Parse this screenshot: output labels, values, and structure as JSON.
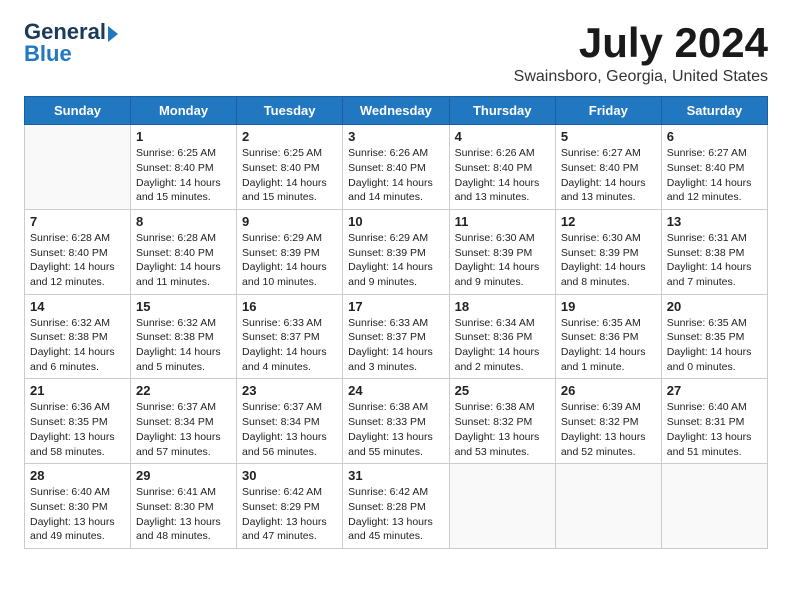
{
  "header": {
    "logo_general": "General",
    "logo_blue": "Blue",
    "month_year": "July 2024",
    "location": "Swainsboro, Georgia, United States"
  },
  "days_of_week": [
    "Sunday",
    "Monday",
    "Tuesday",
    "Wednesday",
    "Thursday",
    "Friday",
    "Saturday"
  ],
  "weeks": [
    [
      {
        "day": "",
        "content": ""
      },
      {
        "day": "1",
        "content": "Sunrise: 6:25 AM\nSunset: 8:40 PM\nDaylight: 14 hours\nand 15 minutes."
      },
      {
        "day": "2",
        "content": "Sunrise: 6:25 AM\nSunset: 8:40 PM\nDaylight: 14 hours\nand 15 minutes."
      },
      {
        "day": "3",
        "content": "Sunrise: 6:26 AM\nSunset: 8:40 PM\nDaylight: 14 hours\nand 14 minutes."
      },
      {
        "day": "4",
        "content": "Sunrise: 6:26 AM\nSunset: 8:40 PM\nDaylight: 14 hours\nand 13 minutes."
      },
      {
        "day": "5",
        "content": "Sunrise: 6:27 AM\nSunset: 8:40 PM\nDaylight: 14 hours\nand 13 minutes."
      },
      {
        "day": "6",
        "content": "Sunrise: 6:27 AM\nSunset: 8:40 PM\nDaylight: 14 hours\nand 12 minutes."
      }
    ],
    [
      {
        "day": "7",
        "content": ""
      },
      {
        "day": "8",
        "content": "Sunrise: 6:28 AM\nSunset: 8:40 PM\nDaylight: 14 hours\nand 11 minutes."
      },
      {
        "day": "9",
        "content": "Sunrise: 6:29 AM\nSunset: 8:39 PM\nDaylight: 14 hours\nand 10 minutes."
      },
      {
        "day": "10",
        "content": "Sunrise: 6:29 AM\nSunset: 8:39 PM\nDaylight: 14 hours\nand 9 minutes."
      },
      {
        "day": "11",
        "content": "Sunrise: 6:30 AM\nSunset: 8:39 PM\nDaylight: 14 hours\nand 9 minutes."
      },
      {
        "day": "12",
        "content": "Sunrise: 6:30 AM\nSunset: 8:39 PM\nDaylight: 14 hours\nand 8 minutes."
      },
      {
        "day": "13",
        "content": "Sunrise: 6:31 AM\nSunset: 8:38 PM\nDaylight: 14 hours\nand 7 minutes."
      }
    ],
    [
      {
        "day": "14",
        "content": "Sunrise: 6:32 AM\nSunset: 8:38 PM\nDaylight: 14 hours\nand 6 minutes."
      },
      {
        "day": "15",
        "content": "Sunrise: 6:32 AM\nSunset: 8:38 PM\nDaylight: 14 hours\nand 5 minutes."
      },
      {
        "day": "16",
        "content": "Sunrise: 6:33 AM\nSunset: 8:37 PM\nDaylight: 14 hours\nand 4 minutes."
      },
      {
        "day": "17",
        "content": "Sunrise: 6:33 AM\nSunset: 8:37 PM\nDaylight: 14 hours\nand 3 minutes."
      },
      {
        "day": "18",
        "content": "Sunrise: 6:34 AM\nSunset: 8:36 PM\nDaylight: 14 hours\nand 2 minutes."
      },
      {
        "day": "19",
        "content": "Sunrise: 6:35 AM\nSunset: 8:36 PM\nDaylight: 14 hours\nand 1 minute."
      },
      {
        "day": "20",
        "content": "Sunrise: 6:35 AM\nSunset: 8:35 PM\nDaylight: 14 hours\nand 0 minutes."
      }
    ],
    [
      {
        "day": "21",
        "content": "Sunrise: 6:36 AM\nSunset: 8:35 PM\nDaylight: 13 hours\nand 58 minutes."
      },
      {
        "day": "22",
        "content": "Sunrise: 6:37 AM\nSunset: 8:34 PM\nDaylight: 13 hours\nand 57 minutes."
      },
      {
        "day": "23",
        "content": "Sunrise: 6:37 AM\nSunset: 8:34 PM\nDaylight: 13 hours\nand 56 minutes."
      },
      {
        "day": "24",
        "content": "Sunrise: 6:38 AM\nSunset: 8:33 PM\nDaylight: 13 hours\nand 55 minutes."
      },
      {
        "day": "25",
        "content": "Sunrise: 6:38 AM\nSunset: 8:32 PM\nDaylight: 13 hours\nand 53 minutes."
      },
      {
        "day": "26",
        "content": "Sunrise: 6:39 AM\nSunset: 8:32 PM\nDaylight: 13 hours\nand 52 minutes."
      },
      {
        "day": "27",
        "content": "Sunrise: 6:40 AM\nSunset: 8:31 PM\nDaylight: 13 hours\nand 51 minutes."
      }
    ],
    [
      {
        "day": "28",
        "content": "Sunrise: 6:40 AM\nSunset: 8:30 PM\nDaylight: 13 hours\nand 49 minutes."
      },
      {
        "day": "29",
        "content": "Sunrise: 6:41 AM\nSunset: 8:30 PM\nDaylight: 13 hours\nand 48 minutes."
      },
      {
        "day": "30",
        "content": "Sunrise: 6:42 AM\nSunset: 8:29 PM\nDaylight: 13 hours\nand 47 minutes."
      },
      {
        "day": "31",
        "content": "Sunrise: 6:42 AM\nSunset: 8:28 PM\nDaylight: 13 hours\nand 45 minutes."
      },
      {
        "day": "",
        "content": ""
      },
      {
        "day": "",
        "content": ""
      },
      {
        "day": "",
        "content": ""
      }
    ]
  ]
}
